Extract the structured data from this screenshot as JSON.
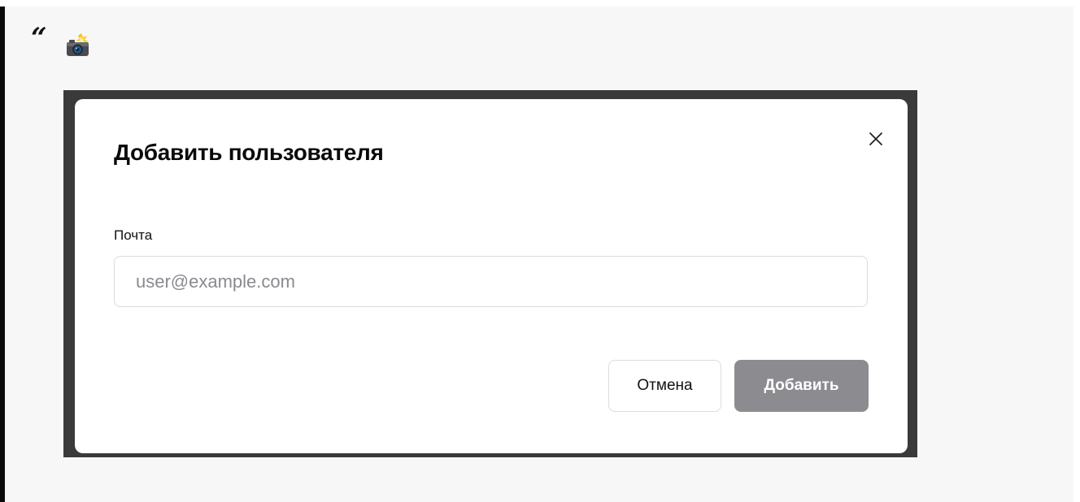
{
  "quote": {
    "mark": "“",
    "icon": "camera-flash-icon"
  },
  "dialog": {
    "title": "Добавить пользователя",
    "close_icon": "close-icon",
    "email_label": "Почта",
    "email_placeholder": "user@example.com",
    "email_value": "",
    "cancel_label": "Отмена",
    "submit_label": "Добавить",
    "submit_enabled": false
  },
  "colors": {
    "quote_background": "#f7f7f7",
    "quote_border": "#0a0a0a",
    "frame_background": "#3a3a3a",
    "dialog_background": "#ffffff",
    "submit_disabled": "#8c8c90",
    "border": "#dcdcde"
  }
}
